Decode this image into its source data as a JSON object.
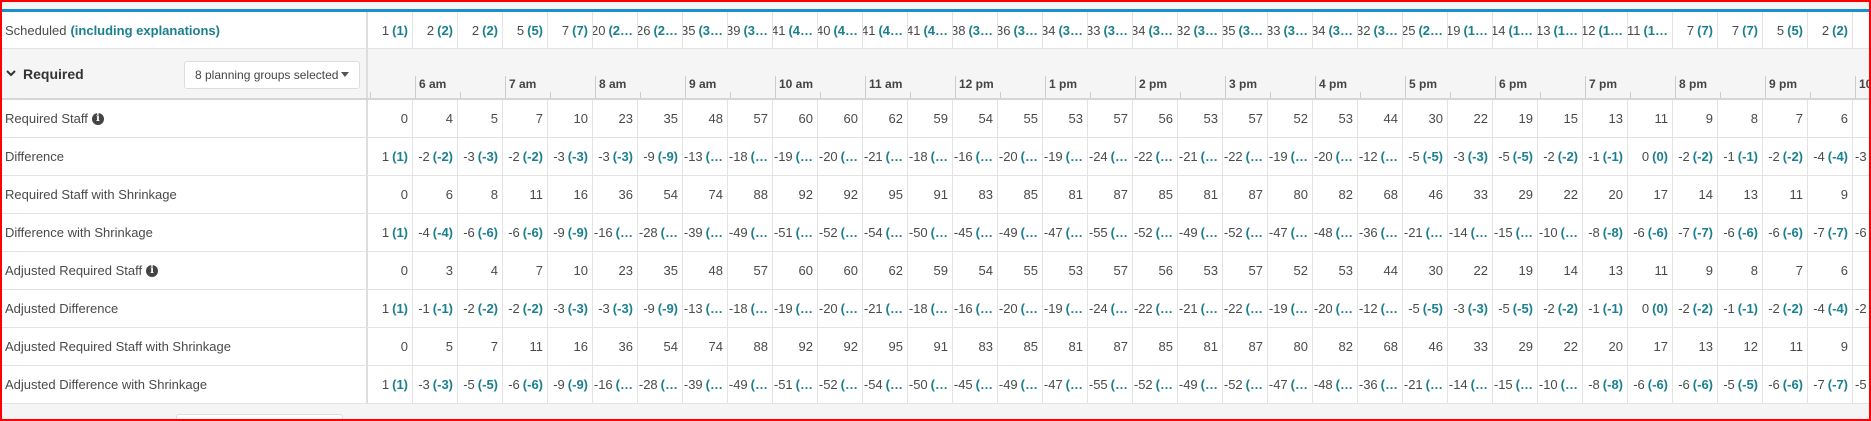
{
  "scheduled": {
    "label": "Scheduled",
    "link": "(including explanations)",
    "values": [
      [
        "1",
        "(1)"
      ],
      [
        "2",
        "(2)"
      ],
      [
        "2",
        "(2)"
      ],
      [
        "5",
        "(5)"
      ],
      [
        "7",
        "(7)"
      ],
      [
        "20",
        "(2…"
      ],
      [
        "26",
        "(2…"
      ],
      [
        "35",
        "(3…"
      ],
      [
        "39",
        "(3…"
      ],
      [
        "41",
        "(4…"
      ],
      [
        "40",
        "(4…"
      ],
      [
        "41",
        "(4…"
      ],
      [
        "41",
        "(4…"
      ],
      [
        "38",
        "(3…"
      ],
      [
        "36",
        "(3…"
      ],
      [
        "34",
        "(3…"
      ],
      [
        "33",
        "(3…"
      ],
      [
        "34",
        "(3…"
      ],
      [
        "32",
        "(3…"
      ],
      [
        "35",
        "(3…"
      ],
      [
        "33",
        "(3…"
      ],
      [
        "34",
        "(3…"
      ],
      [
        "32",
        "(3…"
      ],
      [
        "25",
        "(2…"
      ],
      [
        "19",
        "(1…"
      ],
      [
        "14",
        "(1…"
      ],
      [
        "13",
        "(1…"
      ],
      [
        "12",
        "(1…"
      ],
      [
        "11",
        "(1…"
      ],
      [
        "7",
        "(7)"
      ],
      [
        "7",
        "(7)"
      ],
      [
        "5",
        "(5)"
      ],
      [
        "2",
        "(2)"
      ]
    ]
  },
  "section": {
    "title": "Required",
    "dropdown": "8 planning groups selected"
  },
  "hours": [
    "6 am",
    "7 am",
    "8 am",
    "9 am",
    "10 am",
    "11 am",
    "12 pm",
    "1 pm",
    "2 pm",
    "3 pm",
    "4 pm",
    "5 pm",
    "6 pm",
    "7 pm",
    "8 pm",
    "9 pm",
    "10"
  ],
  "rows": [
    {
      "label": "Required Staff",
      "info": true,
      "values": [
        "0",
        "4",
        "5",
        "7",
        "10",
        "23",
        "35",
        "48",
        "57",
        "60",
        "60",
        "62",
        "59",
        "54",
        "55",
        "53",
        "57",
        "56",
        "53",
        "57",
        "52",
        "53",
        "44",
        "30",
        "22",
        "19",
        "15",
        "13",
        "11",
        "9",
        "8",
        "7",
        "6"
      ]
    },
    {
      "label": "Difference",
      "values": [
        [
          "1",
          "(1)"
        ],
        [
          "-2",
          "(-2)"
        ],
        [
          "-3",
          "(-3)"
        ],
        [
          "-2",
          "(-2)"
        ],
        [
          "-3",
          "(-3)"
        ],
        [
          "-3",
          "(-3)"
        ],
        [
          "-9",
          "(-9)"
        ],
        [
          "-13",
          "(…"
        ],
        [
          "-18",
          "(…"
        ],
        [
          "-19",
          "(…"
        ],
        [
          "-20",
          "(…"
        ],
        [
          "-21",
          "(…"
        ],
        [
          "-18",
          "(…"
        ],
        [
          "-16",
          "(…"
        ],
        [
          "-20",
          "(…"
        ],
        [
          "-19",
          "(…"
        ],
        [
          "-24",
          "(…"
        ],
        [
          "-22",
          "(…"
        ],
        [
          "-21",
          "(…"
        ],
        [
          "-22",
          "(…"
        ],
        [
          "-19",
          "(…"
        ],
        [
          "-20",
          "(…"
        ],
        [
          "-12",
          "(…"
        ],
        [
          "-5",
          "(-5)"
        ],
        [
          "-3",
          "(-3)"
        ],
        [
          "-5",
          "(-5)"
        ],
        [
          "-2",
          "(-2)"
        ],
        [
          "-1",
          "(-1)"
        ],
        [
          "0",
          "(0)"
        ],
        [
          "-2",
          "(-2)"
        ],
        [
          "-1",
          "(-1)"
        ],
        [
          "-2",
          "(-2)"
        ],
        [
          "-4",
          "(-4)"
        ],
        [
          "-3",
          ""
        ]
      ]
    },
    {
      "label": "Required Staff with Shrinkage",
      "values": [
        "0",
        "6",
        "8",
        "11",
        "16",
        "36",
        "54",
        "74",
        "88",
        "92",
        "92",
        "95",
        "91",
        "83",
        "85",
        "81",
        "87",
        "85",
        "81",
        "87",
        "80",
        "82",
        "68",
        "46",
        "33",
        "29",
        "22",
        "20",
        "17",
        "14",
        "13",
        "11",
        "9"
      ]
    },
    {
      "label": "Difference with Shrinkage",
      "values": [
        [
          "1",
          "(1)"
        ],
        [
          "-4",
          "(-4)"
        ],
        [
          "-6",
          "(-6)"
        ],
        [
          "-6",
          "(-6)"
        ],
        [
          "-9",
          "(-9)"
        ],
        [
          "-16",
          "(…"
        ],
        [
          "-28",
          "(…"
        ],
        [
          "-39",
          "(…"
        ],
        [
          "-49",
          "(…"
        ],
        [
          "-51",
          "(…"
        ],
        [
          "-52",
          "(…"
        ],
        [
          "-54",
          "(…"
        ],
        [
          "-50",
          "(…"
        ],
        [
          "-45",
          "(…"
        ],
        [
          "-49",
          "(…"
        ],
        [
          "-47",
          "(…"
        ],
        [
          "-55",
          "(…"
        ],
        [
          "-52",
          "(…"
        ],
        [
          "-49",
          "(…"
        ],
        [
          "-52",
          "(…"
        ],
        [
          "-47",
          "(…"
        ],
        [
          "-48",
          "(…"
        ],
        [
          "-36",
          "(…"
        ],
        [
          "-21",
          "(…"
        ],
        [
          "-14",
          "(…"
        ],
        [
          "-15",
          "(…"
        ],
        [
          "-10",
          "(…"
        ],
        [
          "-8",
          "(-8)"
        ],
        [
          "-6",
          "(-6)"
        ],
        [
          "-7",
          "(-7)"
        ],
        [
          "-6",
          "(-6)"
        ],
        [
          "-6",
          "(-6)"
        ],
        [
          "-7",
          "(-7)"
        ],
        [
          "-6",
          ""
        ]
      ]
    },
    {
      "label": "Adjusted Required Staff",
      "info": true,
      "values": [
        "0",
        "3",
        "4",
        "7",
        "10",
        "23",
        "35",
        "48",
        "57",
        "60",
        "60",
        "62",
        "59",
        "54",
        "55",
        "53",
        "57",
        "56",
        "53",
        "57",
        "52",
        "53",
        "44",
        "30",
        "22",
        "19",
        "14",
        "13",
        "11",
        "9",
        "8",
        "7",
        "6"
      ]
    },
    {
      "label": "Adjusted Difference",
      "values": [
        [
          "1",
          "(1)"
        ],
        [
          "-1",
          "(-1)"
        ],
        [
          "-2",
          "(-2)"
        ],
        [
          "-2",
          "(-2)"
        ],
        [
          "-3",
          "(-3)"
        ],
        [
          "-3",
          "(-3)"
        ],
        [
          "-9",
          "(-9)"
        ],
        [
          "-13",
          "(…"
        ],
        [
          "-18",
          "(…"
        ],
        [
          "-19",
          "(…"
        ],
        [
          "-20",
          "(…"
        ],
        [
          "-21",
          "(…"
        ],
        [
          "-18",
          "(…"
        ],
        [
          "-16",
          "(…"
        ],
        [
          "-20",
          "(…"
        ],
        [
          "-19",
          "(…"
        ],
        [
          "-24",
          "(…"
        ],
        [
          "-22",
          "(…"
        ],
        [
          "-21",
          "(…"
        ],
        [
          "-22",
          "(…"
        ],
        [
          "-19",
          "(…"
        ],
        [
          "-20",
          "(…"
        ],
        [
          "-12",
          "(…"
        ],
        [
          "-5",
          "(-5)"
        ],
        [
          "-3",
          "(-3)"
        ],
        [
          "-5",
          "(-5)"
        ],
        [
          "-2",
          "(-2)"
        ],
        [
          "-1",
          "(-1)"
        ],
        [
          "0",
          "(0)"
        ],
        [
          "-2",
          "(-2)"
        ],
        [
          "-1",
          "(-1)"
        ],
        [
          "-2",
          "(-2)"
        ],
        [
          "-4",
          "(-4)"
        ],
        [
          "-2",
          ""
        ]
      ]
    },
    {
      "label": "Adjusted Required Staff with Shrinkage",
      "values": [
        "0",
        "5",
        "7",
        "11",
        "16",
        "36",
        "54",
        "74",
        "88",
        "92",
        "92",
        "95",
        "91",
        "83",
        "85",
        "81",
        "87",
        "85",
        "81",
        "87",
        "80",
        "82",
        "68",
        "46",
        "33",
        "29",
        "22",
        "20",
        "17",
        "13",
        "12",
        "11",
        "9"
      ]
    },
    {
      "label": "Adjusted Difference with Shrinkage",
      "values": [
        [
          "1",
          "(1)"
        ],
        [
          "-3",
          "(-3)"
        ],
        [
          "-5",
          "(-5)"
        ],
        [
          "-6",
          "(-6)"
        ],
        [
          "-9",
          "(-9)"
        ],
        [
          "-16",
          "(…"
        ],
        [
          "-28",
          "(…"
        ],
        [
          "-39",
          "(…"
        ],
        [
          "-49",
          "(…"
        ],
        [
          "-51",
          "(…"
        ],
        [
          "-52",
          "(…"
        ],
        [
          "-54",
          "(…"
        ],
        [
          "-50",
          "(…"
        ],
        [
          "-45",
          "(…"
        ],
        [
          "-49",
          "(…"
        ],
        [
          "-47",
          "(…"
        ],
        [
          "-55",
          "(…"
        ],
        [
          "-52",
          "(…"
        ],
        [
          "-49",
          "(…"
        ],
        [
          "-52",
          "(…"
        ],
        [
          "-47",
          "(…"
        ],
        [
          "-48",
          "(…"
        ],
        [
          "-36",
          "(…"
        ],
        [
          "-21",
          "(…"
        ],
        [
          "-14",
          "(…"
        ],
        [
          "-15",
          "(…"
        ],
        [
          "-10",
          "(…"
        ],
        [
          "-8",
          "(-8)"
        ],
        [
          "-6",
          "(-6)"
        ],
        [
          "-6",
          "(-6)"
        ],
        [
          "-5",
          "(-5)"
        ],
        [
          "-6",
          "(-6)"
        ],
        [
          "-7",
          "(-7)"
        ],
        [
          "-5",
          ""
        ]
      ]
    }
  ],
  "info_icon": "i",
  "colors": {
    "accent": "#1a7f8e",
    "topline": "#1a8fd0",
    "frame": "#ff0000"
  }
}
